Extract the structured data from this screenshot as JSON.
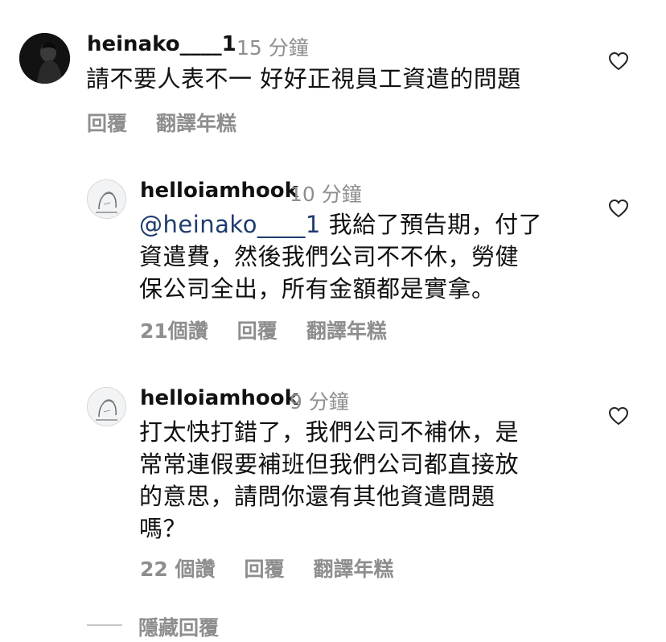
{
  "comments": [
    {
      "username": "heinako____1",
      "time": "15 分鐘",
      "text": "請不要人表不一 好好正視員工資遣的問題",
      "reply_label": "回覆",
      "translate_label": "翻譯年糕"
    }
  ],
  "replies": [
    {
      "username": "helloiamhook",
      "time": "10 分鐘",
      "mention": "@heinako____1",
      "text_line1": " 我給了預告期，付了",
      "text_line2": "資遣費，然後我們公司不不休，勞健",
      "text_line3": "保公司全出，所有金額都是實拿。",
      "likes": "21個讚",
      "reply_label": "回覆",
      "translate_label": "翻譯年糕"
    },
    {
      "username": "helloiamhook",
      "time": "9 分鐘",
      "text_line1": "打太快打錯了，我們公司不補休，是",
      "text_line2": "常常連假要補班但我們公司都直接放",
      "text_line3": "的意思，請問你還有其他資遣問題",
      "text_line4": "嗎？",
      "likes": "22 個讚",
      "reply_label": "回覆",
      "translate_label": "翻譯年糕"
    }
  ],
  "hide_replies_label": "隱藏回覆",
  "colors": {
    "text": "#111111",
    "secondary": "#8e8e8e",
    "mention": "#1f3b6e"
  }
}
